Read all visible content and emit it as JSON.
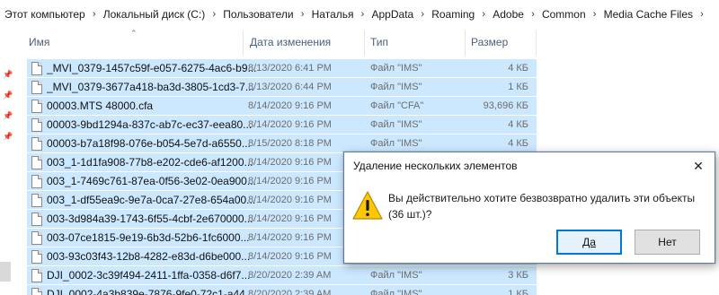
{
  "breadcrumb": [
    "Этот компьютер",
    "Локальный диск (C:)",
    "Пользователи",
    "Наталья",
    "AppData",
    "Roaming",
    "Adobe",
    "Common",
    "Media Cache Files"
  ],
  "columns": {
    "name": "Имя",
    "date": "Дата изменения",
    "type": "Тип",
    "size": "Размер"
  },
  "files": [
    {
      "name": "_MVI_0379-1457c59f-e057-6275-4ac6-b9...",
      "date": "8/13/2020 6:41 PM",
      "type": "Файл \"IMS\"",
      "size": "4 КБ"
    },
    {
      "name": "_MVI_0379-3677a418-ba3d-3805-1cd3-7...",
      "date": "8/13/2020 6:44 PM",
      "type": "Файл \"IMS\"",
      "size": "1 КБ"
    },
    {
      "name": "00003.MTS 48000.cfa",
      "date": "8/14/2020 9:16 PM",
      "type": "Файл \"CFA\"",
      "size": "93,696 КБ"
    },
    {
      "name": "00003-9bd1294a-837c-ab7c-ec37-eea80...",
      "date": "8/14/2020 9:16 PM",
      "type": "Файл \"IMS\"",
      "size": "4 КБ"
    },
    {
      "name": "00003-b7a18f98-076e-b054-5e7d-a6550...",
      "date": "8/15/2020 8:18 PM",
      "type": "Файл \"IMS\"",
      "size": "4 КБ"
    },
    {
      "name": "003_1-1d1fa908-77b8-e202-cde6-af1200...",
      "date": "8/14/2020 9:16 PM",
      "type": "",
      "size": ""
    },
    {
      "name": "003_1-7469c761-87ea-0f56-3e02-0ea900...",
      "date": "8/14/2020 9:16 PM",
      "type": "",
      "size": ""
    },
    {
      "name": "003_1-df55ea9c-9e7a-0ca7-27e8-654a00...",
      "date": "8/14/2020 9:16 PM",
      "type": "",
      "size": ""
    },
    {
      "name": "003-3d984a39-1743-6f55-4cbf-2e670000...",
      "date": "8/14/2020 9:16 PM",
      "type": "",
      "size": ""
    },
    {
      "name": "003-07ce1815-9e19-6b3d-52b6-1fc6000...",
      "date": "8/14/2020 9:16 PM",
      "type": "",
      "size": ""
    },
    {
      "name": "003-93c03f43-12b8-4282-e83d-d6be000...",
      "date": "8/14/2020 9:16 PM",
      "type": "",
      "size": ""
    },
    {
      "name": "DJI_0002-3c39f494-2411-1ffa-0358-d6f7...",
      "date": "8/20/2020 2:39 AM",
      "type": "Файл \"IMS\"",
      "size": "3 КБ"
    },
    {
      "name": "DJI_0002-4a3b839e-7876-9fe0-72c1-a44...",
      "date": "8/20/2020 2:39 AM",
      "type": "Файл \"IMS\"",
      "size": "1 КБ"
    }
  ],
  "dialog": {
    "title": "Удаление нескольких элементов",
    "close_icon": "close-icon",
    "warning_icon": "warning-icon",
    "message": "Вы действительно хотите безвозвратно удалить эти объекты (36 шт.)?",
    "yes_label": "Да",
    "no_label": "Нет"
  },
  "colors": {
    "selection": "#cce8ff",
    "header_text": "#4c607a",
    "dialog_border": "#5c7ea8",
    "default_button_border": "#0078d7",
    "warning_yellow": "#ffc800"
  }
}
